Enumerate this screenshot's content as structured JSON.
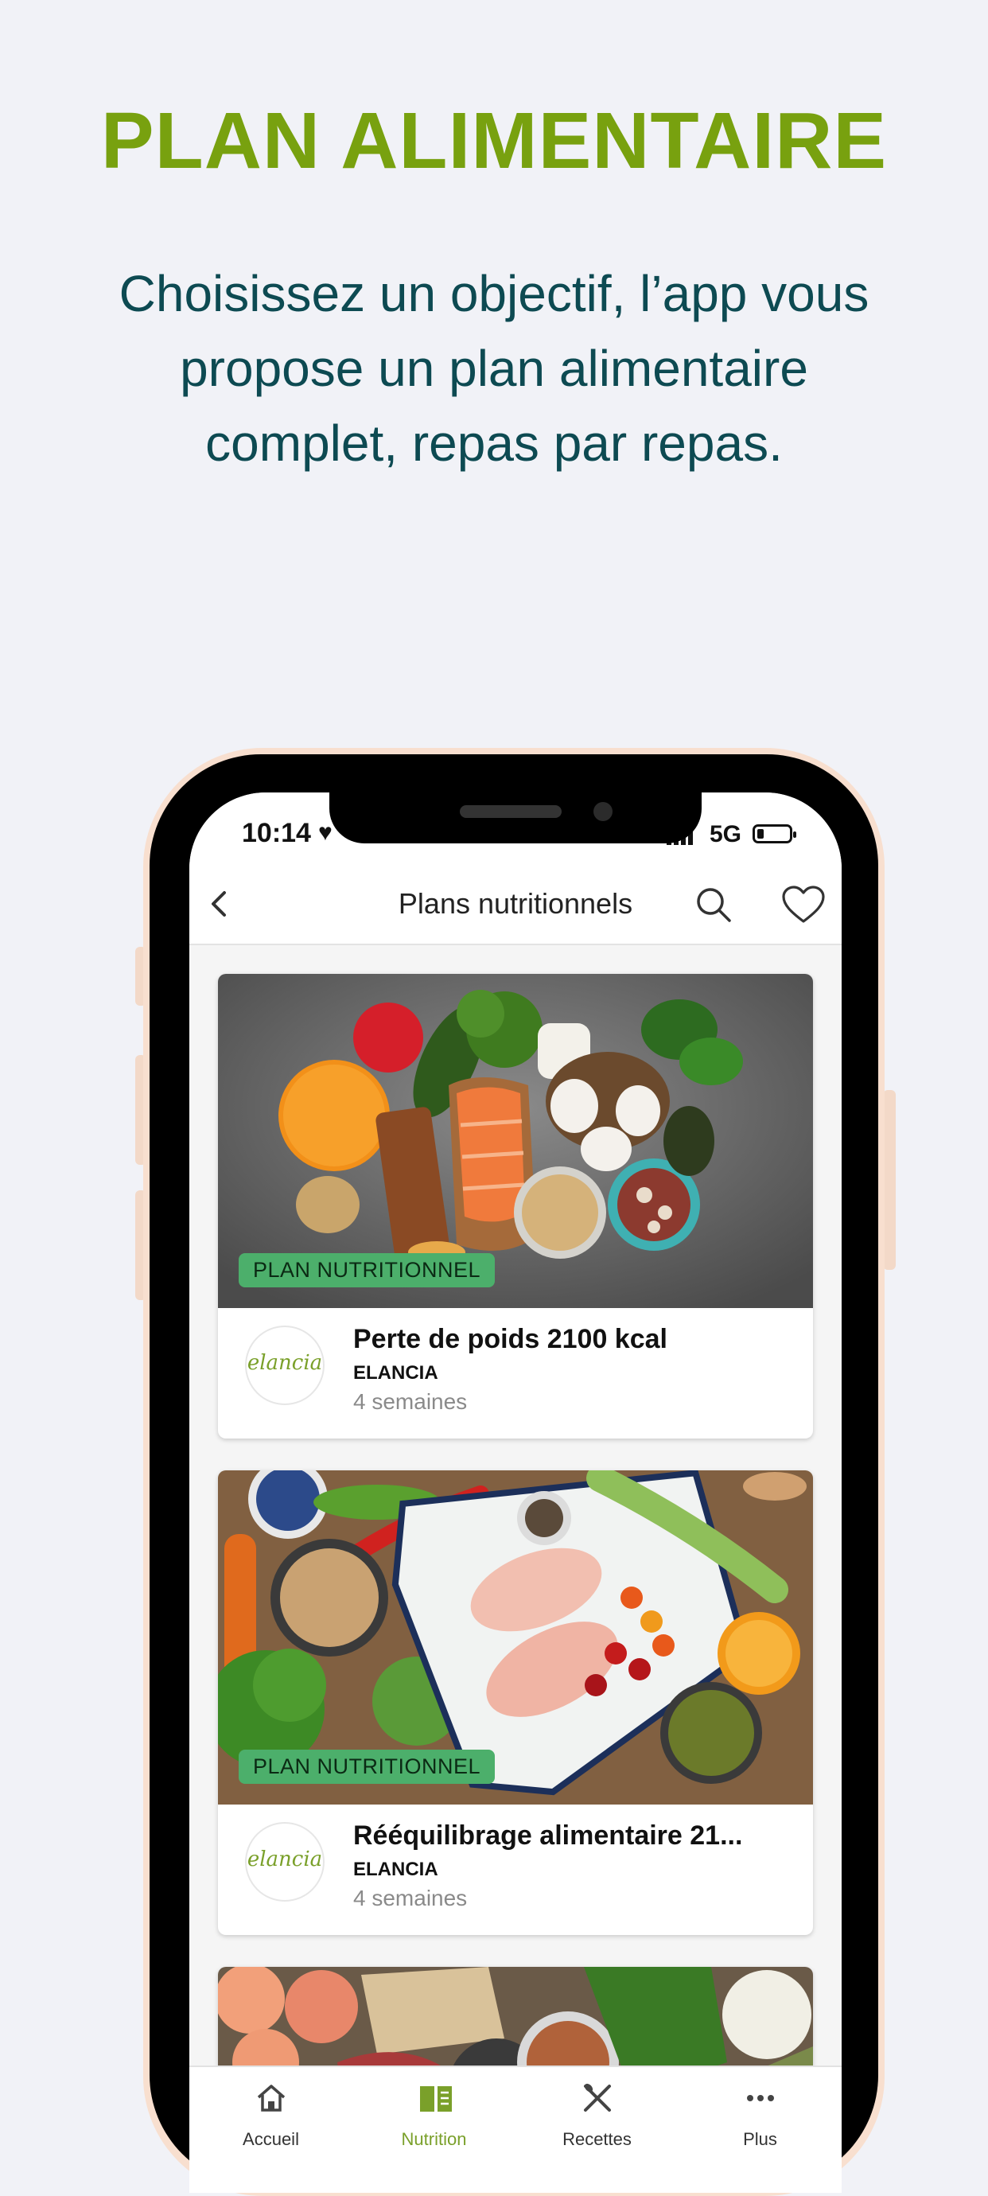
{
  "headline": "PLAN ALIMENTAIRE",
  "subtitle": "Choisissez un objectif, l’app vous propose un plan alimentaire complet, repas par repas.",
  "status_bar": {
    "time": "10:14",
    "network": "5G",
    "battery_level": 0.2
  },
  "nav": {
    "title": "Plans nutritionnels",
    "back_icon": "chevron-left-icon",
    "search_icon": "search-icon",
    "favorite_icon": "heart-icon"
  },
  "cards": [
    {
      "badge": "PLAN NUTRITIONNEL",
      "title": "Perte de poids 2100 kcal",
      "brand": "ELANCIA",
      "duration": "4 semaines",
      "logo": "elancia"
    },
    {
      "badge": "PLAN NUTRITIONNEL",
      "title": "Rééquilibrage alimentaire 21...",
      "brand": "ELANCIA",
      "duration": "4 semaines",
      "logo": "elancia"
    }
  ],
  "tabs": [
    {
      "label": "Accueil",
      "icon": "home-icon",
      "active": false
    },
    {
      "label": "Nutrition",
      "icon": "book-icon",
      "active": true
    },
    {
      "label": "Recettes",
      "icon": "utensils-icon",
      "active": false
    },
    {
      "label": "Plus",
      "icon": "more-icon",
      "active": false
    }
  ],
  "colors": {
    "accent": "#78a10f",
    "subtitle": "#0d4a52",
    "badge": "#4caf6b"
  }
}
